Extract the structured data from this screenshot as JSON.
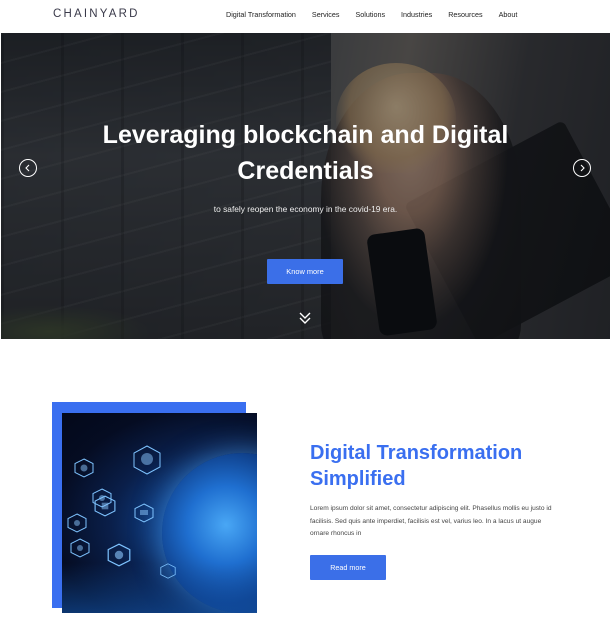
{
  "header": {
    "logo": "CHAINYARD",
    "nav": [
      "Digital Transformation",
      "Services",
      "Solutions",
      "Industries",
      "Resources",
      "About"
    ]
  },
  "hero": {
    "title_line1": "Leveraging blockchain and Digital",
    "title_line2": "Credentials",
    "subtitle": "to safely reopen the economy in the covid-19 era.",
    "button": "Know more"
  },
  "feature": {
    "title_line1": "Digital Transformation",
    "title_line2": "Simplified",
    "text": "Lorem ipsum dolor sit amet, consectetur adipiscing elit. Phasellus mollis eu justo id facilisis. Sed quis ante imperdiet, facilisis est vel, varius leo. In a lacus ut augue ornare rhoncus in",
    "button": "Read more"
  },
  "colors": {
    "accent": "#3b6fe8",
    "feature_block": "#3a6ff0"
  }
}
